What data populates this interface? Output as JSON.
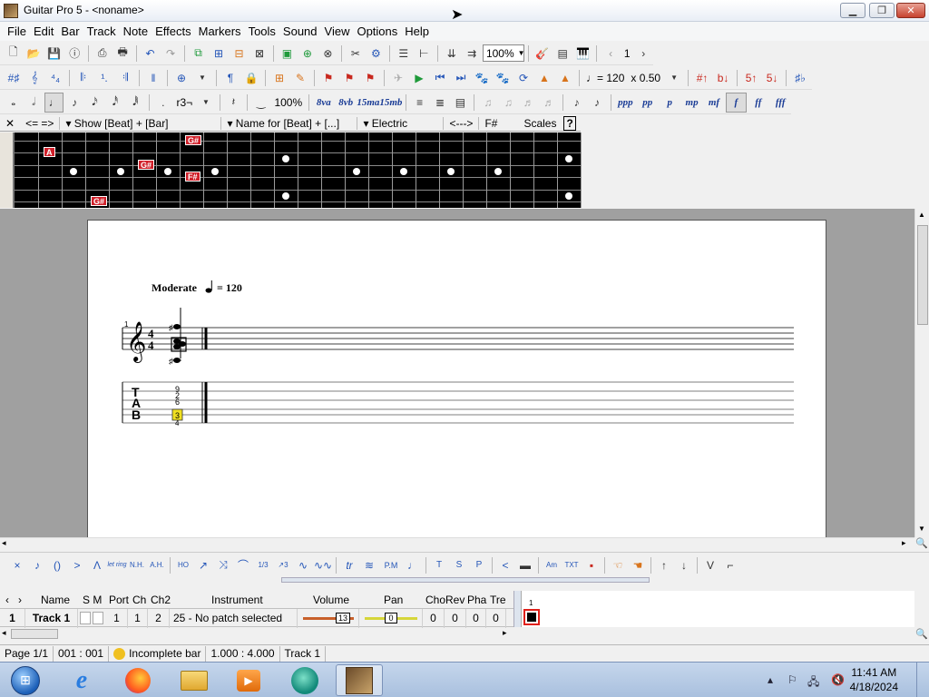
{
  "window": {
    "title": "Guitar Pro 5 - <noname>",
    "min": "▁",
    "max": "❐",
    "close": "✕"
  },
  "menu": [
    "File",
    "Edit",
    "Bar",
    "Track",
    "Note",
    "Effects",
    "Markers",
    "Tools",
    "Sound",
    "View",
    "Options",
    "Help"
  ],
  "toolbar1": {
    "zoom": "100%",
    "page_number": "1"
  },
  "toolbar2": {
    "tempo": "♩= 120",
    "speed": "x 0.50"
  },
  "toolbar3": {
    "triplet": "r3¬",
    "velocity_pct": "100%",
    "octave_8va": "8va",
    "octave_8vb": "8vb",
    "octave_15ma": "15ma",
    "octave_15mb": "15mb",
    "dynamics": [
      "ppp",
      "pp",
      "p",
      "mp",
      "mf",
      "f",
      "ff",
      "fff"
    ]
  },
  "fretboard_header": {
    "nav": "<= =>",
    "show": "Show [Beat] + [Bar]",
    "name_for": "Name for [Beat] + [...]",
    "guitar_type": "Electric",
    "arrows": "<--->",
    "key": "F#",
    "scales": "Scales",
    "help": "?"
  },
  "fretboard_notes": [
    {
      "label": "G#",
      "fret": 8,
      "string": 1
    },
    {
      "label": "A",
      "fret": 2,
      "string": 2
    },
    {
      "label": "G#",
      "fret": 6,
      "string": 3
    },
    {
      "label": "F#",
      "fret": 8,
      "string": 4
    },
    {
      "label": "G#",
      "fret": 4,
      "string": 6
    }
  ],
  "score": {
    "tempo_text": "Moderate",
    "tempo_value": "= 120",
    "measure_number": "1",
    "time_sig_top": "4",
    "time_sig_bottom": "4",
    "tab_label": [
      "T",
      "A",
      "B"
    ],
    "tab_frets": [
      "9",
      "2",
      "6",
      "",
      "3",
      "4"
    ]
  },
  "fx_toolbar": {
    "items": [
      "×",
      "♪",
      "()",
      ">",
      "Λ",
      "let ring",
      "N.H.",
      "A.H.",
      "HO",
      "↗",
      "⤨",
      "⌒",
      "1/3",
      "↗3",
      "∿",
      "∿∿",
      "tr",
      "≋",
      "P.M",
      "♩",
      "T",
      "S",
      "P",
      "<",
      "▬",
      "Am",
      "TXT",
      "▪",
      "☜",
      "☚",
      "↑",
      "↓",
      "V",
      "⌐"
    ]
  },
  "track_panel": {
    "headers": [
      "Name",
      "S M",
      "Port",
      "Ch",
      "Ch2",
      "Instrument",
      "Volume",
      "Pan",
      "Cho",
      "Rev",
      "Pha",
      "Tre"
    ],
    "row": {
      "number": "1",
      "name": "Track 1",
      "port": "1",
      "ch": "1",
      "ch2": "2",
      "instrument": "25 - No patch selected",
      "volume": "13",
      "pan": "0",
      "cho": "0",
      "rev": "0",
      "pha": "0",
      "tre": "0"
    },
    "bar_number": "1"
  },
  "status": {
    "page": "Page 1/1",
    "position": "001 : 001",
    "warning": "Incomplete bar",
    "duration": "1.000 : 4.000",
    "track": "Track 1"
  },
  "taskbar": {
    "time": "11:41 AM",
    "date": "4/18/2024"
  }
}
